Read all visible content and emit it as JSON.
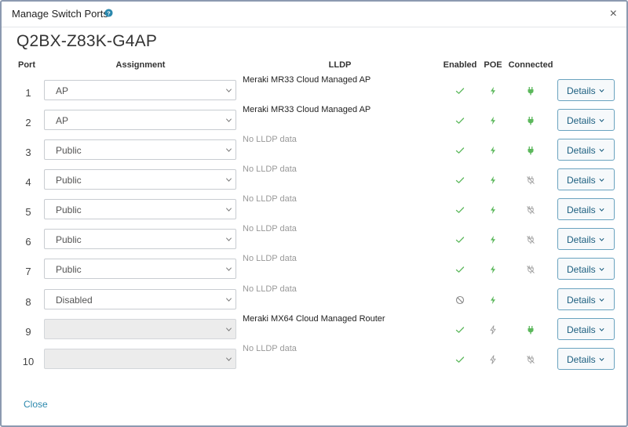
{
  "modal": {
    "title": "Manage Switch Ports",
    "help_icon": "help-circle-icon",
    "close_icon": "close-icon",
    "close_symbol": "×"
  },
  "device": {
    "serial": "Q2BX-Z83K-G4AP"
  },
  "table": {
    "headers": {
      "port": "Port",
      "assignment": "Assignment",
      "lldp": "LLDP",
      "enabled": "Enabled",
      "poe": "POE",
      "connected": "Connected"
    },
    "rows": [
      {
        "port": "1",
        "assignment": "AP",
        "assignment_disabled": false,
        "lldp": "Meraki MR33 Cloud Managed AP",
        "lldp_empty": false,
        "enabled": "check",
        "poe": "bolt-active",
        "connected": "plug-connected"
      },
      {
        "port": "2",
        "assignment": "AP",
        "assignment_disabled": false,
        "lldp": "Meraki MR33 Cloud Managed AP",
        "lldp_empty": false,
        "enabled": "check",
        "poe": "bolt-active",
        "connected": "plug-connected"
      },
      {
        "port": "3",
        "assignment": "Public",
        "assignment_disabled": false,
        "lldp": "No LLDP data",
        "lldp_empty": true,
        "enabled": "check",
        "poe": "bolt-active",
        "connected": "plug-connected"
      },
      {
        "port": "4",
        "assignment": "Public",
        "assignment_disabled": false,
        "lldp": "No LLDP data",
        "lldp_empty": true,
        "enabled": "check",
        "poe": "bolt-active",
        "connected": "plug-disconnected"
      },
      {
        "port": "5",
        "assignment": "Public",
        "assignment_disabled": false,
        "lldp": "No LLDP data",
        "lldp_empty": true,
        "enabled": "check",
        "poe": "bolt-active",
        "connected": "plug-disconnected"
      },
      {
        "port": "6",
        "assignment": "Public",
        "assignment_disabled": false,
        "lldp": "No LLDP data",
        "lldp_empty": true,
        "enabled": "check",
        "poe": "bolt-active",
        "connected": "plug-disconnected"
      },
      {
        "port": "7",
        "assignment": "Public",
        "assignment_disabled": false,
        "lldp": "No LLDP data",
        "lldp_empty": true,
        "enabled": "check",
        "poe": "bolt-active",
        "connected": "plug-disconnected"
      },
      {
        "port": "8",
        "assignment": "Disabled",
        "assignment_disabled": false,
        "lldp": "No LLDP data",
        "lldp_empty": true,
        "enabled": "disabled",
        "poe": "bolt-active",
        "connected": "none"
      },
      {
        "port": "9",
        "assignment": "",
        "assignment_disabled": true,
        "lldp": "Meraki MX64 Cloud Managed Router",
        "lldp_empty": false,
        "enabled": "check",
        "poe": "bolt-inactive",
        "connected": "plug-connected"
      },
      {
        "port": "10",
        "assignment": "",
        "assignment_disabled": true,
        "lldp": "No LLDP data",
        "lldp_empty": true,
        "enabled": "check",
        "poe": "bolt-inactive",
        "connected": "plug-disconnected"
      }
    ],
    "details_label": "Details"
  },
  "footer": {
    "close_label": "Close"
  },
  "colors": {
    "accent": "#2b88ad",
    "success_green": "#5cb85c",
    "muted_gray": "#9a9a9a",
    "details_border": "#6aa3bf"
  }
}
